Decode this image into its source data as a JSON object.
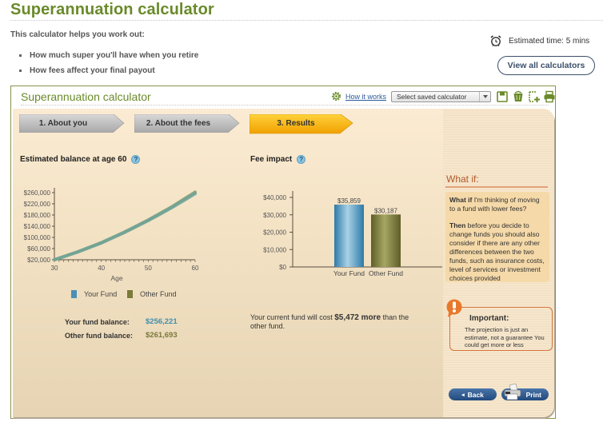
{
  "page": {
    "title": "Superannuation calculator",
    "intro": "This calculator helps you work out:",
    "bullets": [
      "How much super you'll have when you retire",
      "How fees affect your final payout"
    ],
    "estimated_time": "Estimated time: 5 mins",
    "view_all_label": "View all calculators"
  },
  "calculator": {
    "title": "Superannuation calculator",
    "how_it_works": "How it works",
    "saved_select": "Select saved calculator",
    "toolbar_icons": [
      "save-icon",
      "delete-icon",
      "new-icon",
      "print-icon"
    ],
    "steps": [
      {
        "label": "1. About you",
        "active": false
      },
      {
        "label": "2. About the fees",
        "active": false
      },
      {
        "label": "3. Results",
        "active": true
      }
    ],
    "balance": {
      "title": "Estimated balance at age 60",
      "legend": [
        {
          "label": "Your Fund",
          "color": "#4a90b8"
        },
        {
          "label": "Other Fund",
          "color": "#7a7a3a"
        }
      ],
      "your_fund_label": "Your fund balance:",
      "your_fund_value": "$256,221",
      "other_fund_label": "Other fund balance:",
      "other_fund_value": "$261,693",
      "your_fund_color": "#3f8fb0",
      "other_fund_color": "#7a7a3a"
    },
    "fee_impact": {
      "title": "Fee impact",
      "note_prefix": "Your current fund will cost",
      "note_amount": "$5,472 more",
      "note_suffix": "than the other fund."
    },
    "what_if": {
      "title": "What if:",
      "q_bold": "What if",
      "q_text": " I'm thinking of moving to a fund with lower fees?",
      "a_bold": "Then",
      "a_text": " before you decide to change funds you should also consider if there are any other differences between the two funds, such as insurance costs, level of services or investment choices provided"
    },
    "important": {
      "title": "Important:",
      "text": "The projection is just an estimate, not a guarantee  You could get more or less"
    },
    "back_label": "Back",
    "print_label": "Print"
  },
  "chart_data": [
    {
      "type": "line",
      "title": "Estimated balance at age 60",
      "xlabel": "Age",
      "ylabel": "",
      "x": [
        30,
        35,
        40,
        45,
        50,
        55,
        60
      ],
      "xticks": [
        "30",
        "40",
        "50",
        "60"
      ],
      "yticks": [
        "$20,000",
        "$60,000",
        "$100,000",
        "$140,000",
        "$180,000",
        "$220,000",
        "$260,000"
      ],
      "xlim": [
        30,
        60
      ],
      "ylim": [
        20000,
        260000
      ],
      "series": [
        {
          "name": "Your Fund",
          "color": "#4a90b8",
          "values": [
            20000,
            48000,
            80000,
            118000,
            160000,
            206000,
            256221
          ]
        },
        {
          "name": "Other Fund",
          "color": "#7a7a3a",
          "values": [
            20000,
            48500,
            81000,
            119500,
            162000,
            209000,
            261693
          ]
        }
      ],
      "legend": "bottom",
      "grid": false
    },
    {
      "type": "bar",
      "title": "Fee impact",
      "categories": [
        "Your Fund",
        "Other Fund"
      ],
      "values": [
        35859,
        30187
      ],
      "data_labels": [
        "$35,859",
        "$30,187"
      ],
      "colors": [
        "#4a9ac4",
        "#7d7d3c"
      ],
      "yticks": [
        "$0",
        "$10,000",
        "$20,000",
        "$30,000",
        "$40,000"
      ],
      "ylim": [
        0,
        40000
      ],
      "xlabel": "",
      "ylabel": "",
      "grid": false
    }
  ]
}
